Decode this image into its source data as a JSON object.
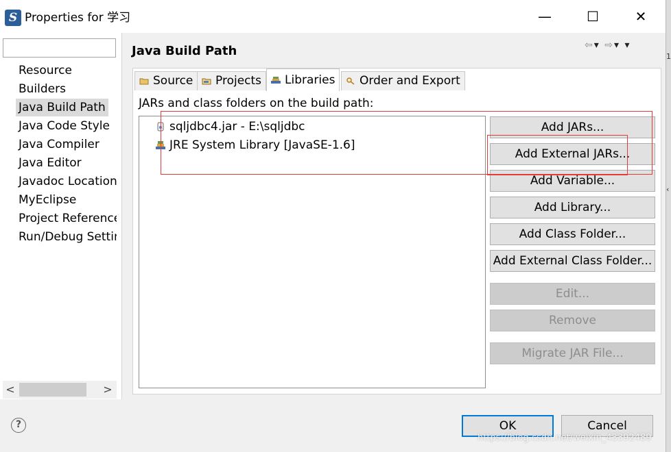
{
  "window": {
    "app_icon_letter": "S",
    "title": "Properties for 学习",
    "minimize_glyph": "—",
    "maximize_glyph": "☐",
    "close_glyph": "✕",
    "edge_glyph_top": "1",
    "edge_glyph_mid": "‹"
  },
  "sidebar": {
    "filter_value": "",
    "items": [
      {
        "label": "Resource"
      },
      {
        "label": "Builders"
      },
      {
        "label": "Java Build Path"
      },
      {
        "label": "Java Code Style"
      },
      {
        "label": "Java Compiler"
      },
      {
        "label": "Java Editor"
      },
      {
        "label": "Javadoc Location"
      },
      {
        "label": "MyEclipse"
      },
      {
        "label": "Project References"
      },
      {
        "label": "Run/Debug Settings"
      }
    ],
    "selected_index": 2,
    "scroll_left": "<",
    "scroll_right": ">"
  },
  "page": {
    "title": "Java Build Path",
    "nav_glyphs": {
      "back": "⇦",
      "back_menu": "▾",
      "forward": "⇨",
      "forward_menu": "▾",
      "view_menu": "▾"
    }
  },
  "tabs": [
    {
      "label": "Source",
      "icon": "source-folder-icon"
    },
    {
      "label": "Projects",
      "icon": "projects-icon"
    },
    {
      "label": "Libraries",
      "icon": "libraries-icon",
      "active": true
    },
    {
      "label": "Order and Export",
      "icon": "order-export-icon"
    }
  ],
  "libraries": {
    "section_label": "JARs and class folders on the build path:",
    "entries": [
      {
        "label": "sqljdbc4.jar - E:\\sqljdbc",
        "icon": "jar-icon"
      },
      {
        "label": "JRE System Library [JavaSE-1.6]",
        "icon": "library-icon"
      }
    ]
  },
  "buttons": {
    "add_jars": "Add JARs...",
    "add_external_jars": "Add External JARs...",
    "add_variable": "Add Variable...",
    "add_library": "Add Library...",
    "add_class_folder": "Add Class Folder...",
    "add_external_class_folder": "Add External Class Folder...",
    "edit": "Edit...",
    "remove": "Remove",
    "migrate_jar": "Migrate JAR File..."
  },
  "footer": {
    "help_glyph": "?",
    "ok": "OK",
    "cancel": "Cancel",
    "watermark": "https://blog.csdn.net/weixin_43392489"
  },
  "colors": {
    "annotation_red": "#e53935",
    "focus_blue": "#0078d7",
    "selection_gray": "#dadada"
  }
}
